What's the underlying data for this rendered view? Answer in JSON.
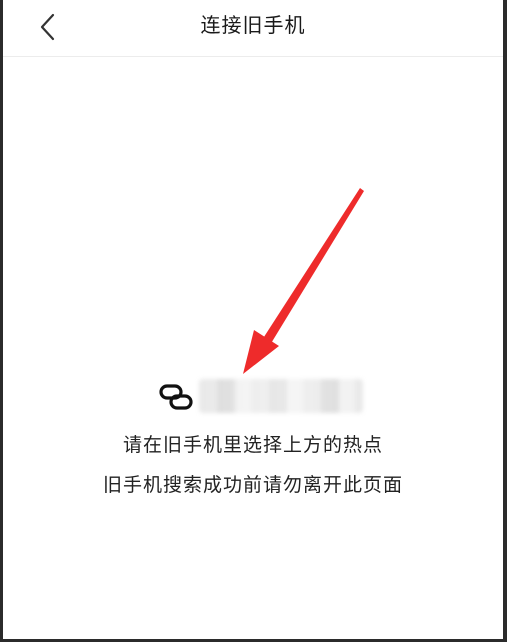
{
  "header": {
    "title": "连接旧手机",
    "back_icon": "chevron-left-icon"
  },
  "hotspot": {
    "icon": "link-icon",
    "name": ""
  },
  "instructions": {
    "line1": "请在旧手机里选择上方的热点",
    "line2": "旧手机搜索成功前请勿离开此页面"
  },
  "colors": {
    "background": "#ffffff",
    "text": "#222222",
    "annotation_arrow": "#ee2b2b"
  }
}
